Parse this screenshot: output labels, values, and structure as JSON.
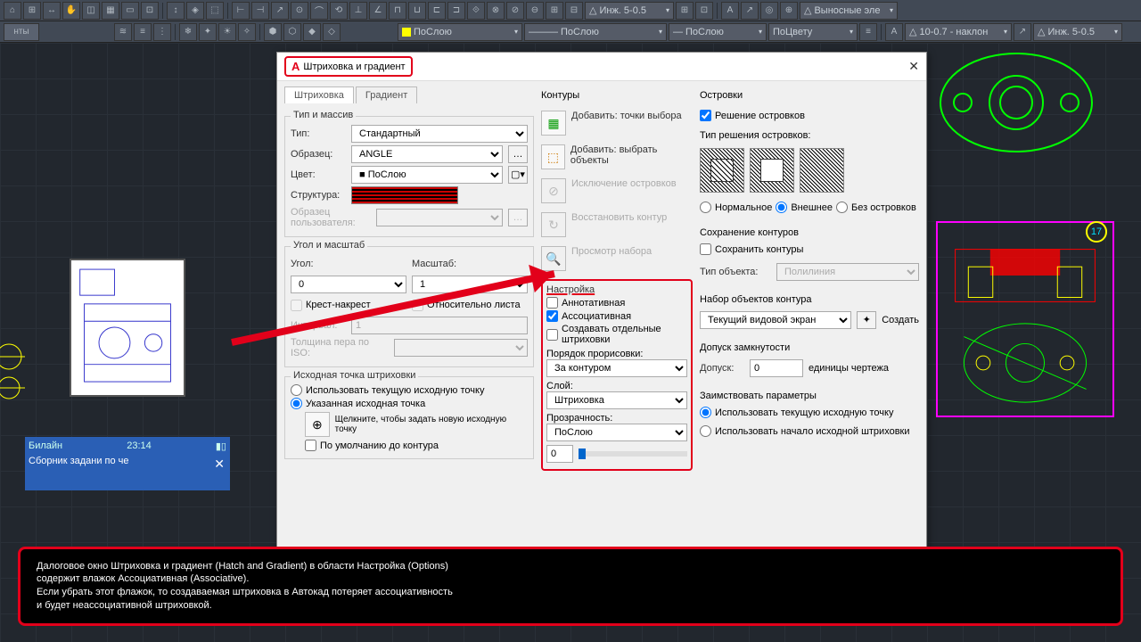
{
  "toolbar": {
    "drop1": "Инж. 5-0.5",
    "drop2": "Выносные эле",
    "bylayer": "ПоСлою",
    "bycolor": "ПоЦвету",
    "dimstyle": "10-0.7 - наклон",
    "arrowstyle": "Инж. 5-0.5",
    "tab_left": "нты"
  },
  "dialog": {
    "title": "Штриховка и градиент",
    "tab1": "Штриховка",
    "tab2": "Градиент",
    "group_type": "Тип и массив",
    "type_label": "Тип:",
    "type_val": "Стандартный",
    "pattern_label": "Образец:",
    "pattern_val": "ANGLE",
    "color_label": "Цвет:",
    "color_val": "ПоСлою",
    "struct_label": "Структура:",
    "userpat_label": "Образец пользователя:",
    "group_angle": "Угол и масштаб",
    "angle_label": "Угол:",
    "angle_val": "0",
    "scale_label": "Масштаб:",
    "scale_val": "1",
    "crosshatch": "Крест-накрест",
    "relsheet": "Относительно листа",
    "interval_label": "Интервал:",
    "interval_val": "1",
    "iso_label": "Толщина пера по ISO:",
    "group_origin": "Исходная точка штриховки",
    "origin_current": "Использовать текущую исходную точку",
    "origin_set": "Указанная исходная точка",
    "origin_click": "Щелкните, чтобы задать новую исходную точку",
    "origin_default": "По умолчанию до контура",
    "contours": "Контуры",
    "add_points": "Добавить: точки выбора",
    "add_select": "Добавить: выбрать объекты",
    "exclude": "Исключение островков",
    "restore": "Восстановить контур",
    "preview": "Просмотр набора",
    "settings": "Настройка",
    "annotative": "Аннотативная",
    "associative": "Ассоциативная",
    "separate": "Создавать отдельные штриховки",
    "draworder_label": "Порядок прорисовки:",
    "draworder_val": "За контуром",
    "layer_label": "Слой:",
    "layer_val": "Штриховка",
    "transp_label": "Прозрачность:",
    "transp_val": "ПоСлою",
    "transp_num": "0",
    "islands": "Островки",
    "island_detect": "Решение островков",
    "island_type": "Тип решения островков:",
    "island_normal": "Нормальное",
    "island_outer": "Внешнее",
    "island_none": "Без островков",
    "retain": "Сохранение контуров",
    "retain_chk": "Сохранить контуры",
    "objtype_label": "Тип объекта:",
    "objtype_val": "Полилиния",
    "boundset": "Набор объектов контура",
    "boundset_val": "Текущий видовой экран",
    "boundset_new": "Создать",
    "gap": "Допуск замкнутости",
    "gap_label": "Допуск:",
    "gap_val": "0",
    "gap_units": "единицы чертежа",
    "inherit": "Заимствовать параметры",
    "inherit_cur": "Использовать текущую исходную точку",
    "inherit_src": "Использовать начало исходной штриховки"
  },
  "caption": {
    "l1": "Далоговое окно Штриховка и градиент (Hatch and Gradient) в области Настройка (Options)",
    "l2": "содержит влажок Ассоциативная (Associative).",
    "l3": "Если убрать этот флажок, то создаваемая штриховка в Автокад потеряет ассоциативность",
    "l4": "и будет неассоциативной штриховкой."
  },
  "thumb2": {
    "carrier": "Билайн",
    "time": "23:14",
    "title": "Сборник задани по че"
  },
  "dwg2_num": "17"
}
